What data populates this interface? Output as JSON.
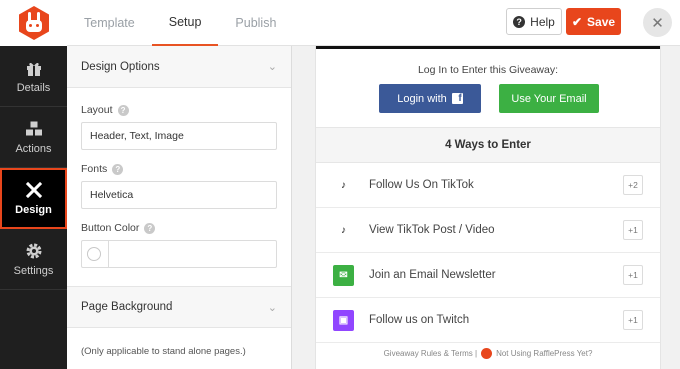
{
  "header": {
    "tabs": [
      {
        "label": "Template",
        "active": false
      },
      {
        "label": "Setup",
        "active": true
      },
      {
        "label": "Publish",
        "active": false
      }
    ],
    "help_label": "Help",
    "save_label": "Save",
    "close_glyph": "✕",
    "accent_color": "#e8461c"
  },
  "sidebar": {
    "items": [
      {
        "label": "Details",
        "icon": "gift-icon",
        "active": false
      },
      {
        "label": "Actions",
        "icon": "cubes-icon",
        "active": false
      },
      {
        "label": "Design",
        "icon": "pencil-ruler-icon",
        "active": true
      },
      {
        "label": "Settings",
        "icon": "gear-icon",
        "active": false
      }
    ]
  },
  "panel": {
    "design_options": {
      "title": "Design Options",
      "layout_label": "Layout",
      "layout_value": "Header, Text, Image",
      "fonts_label": "Fonts",
      "fonts_value": "Helvetica",
      "button_color_label": "Button Color"
    },
    "page_background": {
      "title": "Page Background",
      "note": "(Only applicable to stand alone pages.)"
    }
  },
  "preview": {
    "login_text": "Log In to Enter this Giveaway:",
    "login_facebook_label": "Login with",
    "login_email_label": "Use Your Email",
    "ways_title": "4 Ways to Enter",
    "entries": [
      {
        "label": "Follow Us On TikTok",
        "points": "+2",
        "icon": "tiktok-icon"
      },
      {
        "label": "View TikTok Post / Video",
        "points": "+1",
        "icon": "tiktok-icon"
      },
      {
        "label": "Join an Email Newsletter",
        "points": "+1",
        "icon": "email-icon"
      },
      {
        "label": "Follow us on Twitch",
        "points": "+1",
        "icon": "twitch-icon"
      }
    ],
    "footer_left": "Giveaway Rules & Terms |",
    "footer_right": "Not Using RafflePress Yet?",
    "colors": {
      "facebook": "#3b5998",
      "email_button": "#3cb043",
      "email_icon": "#3cb043",
      "twitch_icon": "#9146ff"
    }
  }
}
